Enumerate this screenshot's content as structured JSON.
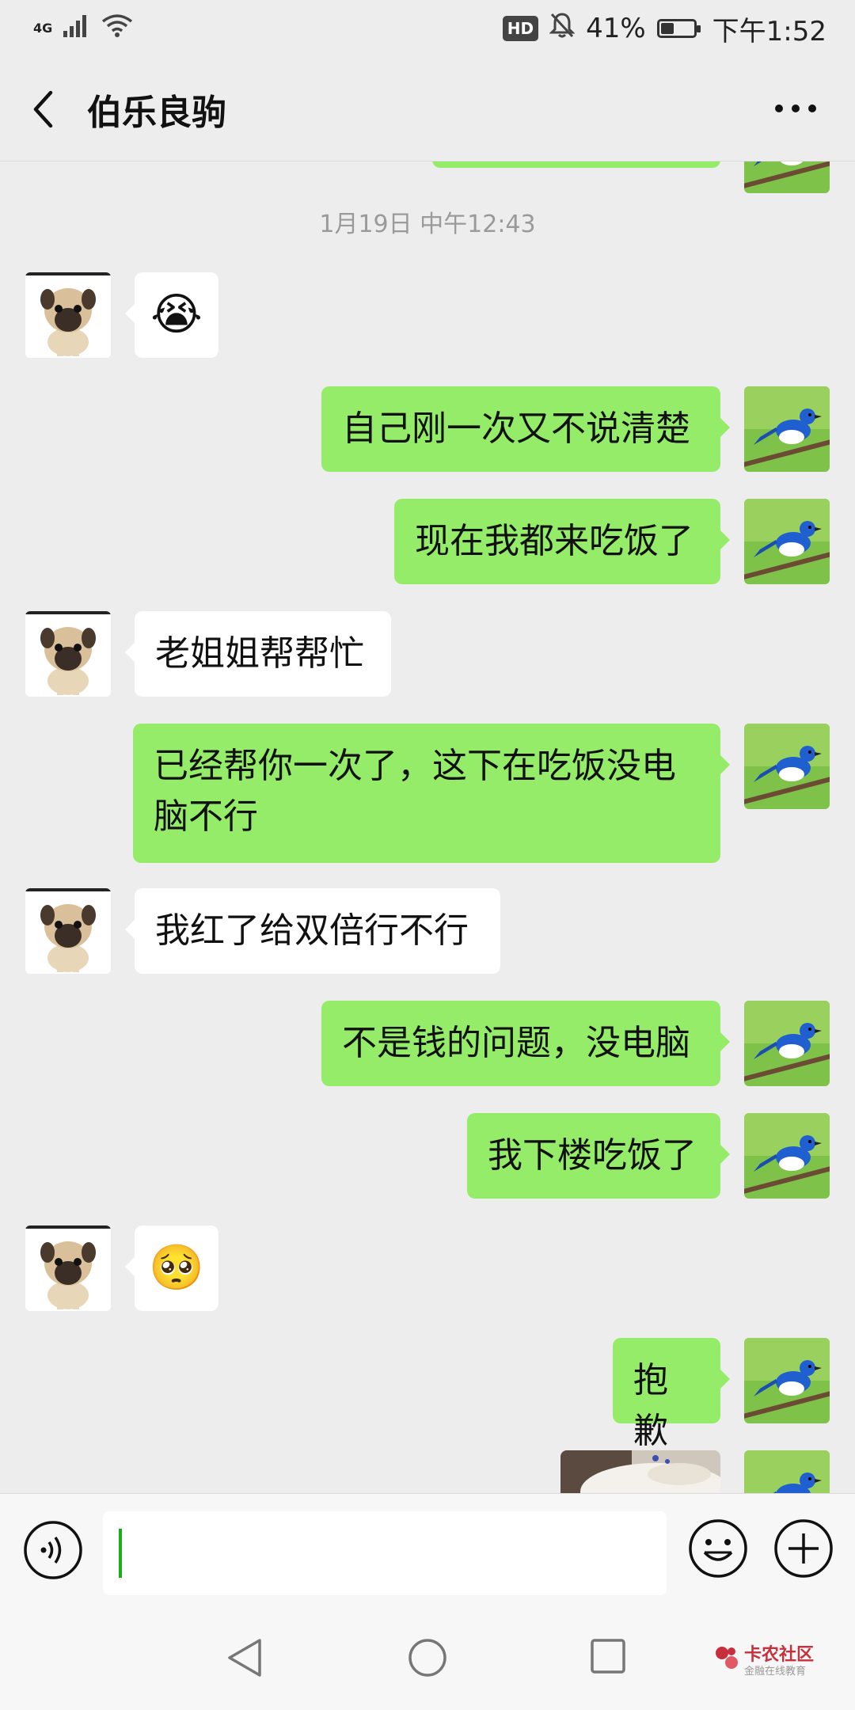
{
  "status_bar": {
    "network": "4G",
    "hd": "HD",
    "battery": "41%",
    "battery_level": 0.41,
    "time": "下午1:52"
  },
  "header": {
    "title": "伯乐良驹"
  },
  "chat": {
    "timestamp": "1月19日 中午12:43",
    "messages": [
      {
        "side": "in",
        "type": "emoji",
        "emoji": "😭"
      },
      {
        "side": "out",
        "type": "text",
        "text": "自己刚一次又不说清楚"
      },
      {
        "side": "out",
        "type": "text",
        "text": "现在我都来吃饭了"
      },
      {
        "side": "in",
        "type": "text",
        "text": "老姐姐帮帮忙"
      },
      {
        "side": "out",
        "type": "text",
        "text": "已经帮你一次了，这下在吃饭没电脑不行"
      },
      {
        "side": "in",
        "type": "text",
        "text": "我红了给双倍行不行"
      },
      {
        "side": "out",
        "type": "text",
        "text": "不是钱的问题，没电脑"
      },
      {
        "side": "out",
        "type": "text",
        "text": "我下楼吃饭了"
      },
      {
        "side": "in",
        "type": "emoji",
        "emoji": "🥺"
      },
      {
        "side": "out",
        "type": "text",
        "text": "抱歉"
      },
      {
        "side": "out",
        "type": "image",
        "text": ""
      }
    ]
  },
  "watermark": {
    "line1": "卡农社区",
    "line2": "金融在线教育"
  },
  "colors": {
    "outgoing_bubble": "#95ec69",
    "incoming_bubble": "#ffffff",
    "background": "#ededed"
  }
}
